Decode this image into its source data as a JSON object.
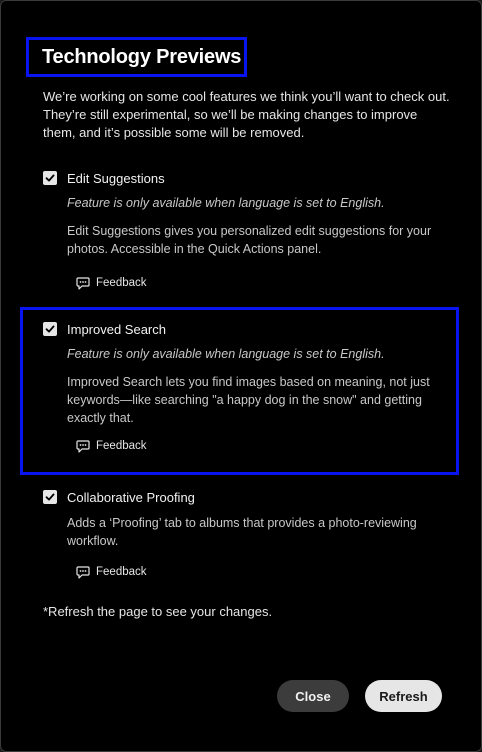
{
  "dialog": {
    "title": "Technology Previews",
    "intro": "We’re working on some cool features we think you’ll want to check out. They’re still experimental, so we’ll be making changes to improve them, and it’s possible some will be removed.",
    "footnote": "*Refresh the page to see your changes.",
    "close_label": "Close",
    "refresh_label": "Refresh",
    "highlight_color": "#0a14f0"
  },
  "features": [
    {
      "name": "Edit Suggestions",
      "checked": true,
      "note": "Feature is only available when language is set to English.",
      "description": "Edit Suggestions gives you personalized edit suggestions for your photos. Accessible in the Quick Actions panel.",
      "feedback_label": "Feedback"
    },
    {
      "name": "Improved Search",
      "checked": true,
      "note": "Feature is only available when language is set to English.",
      "description": "Improved Search lets you find images based on meaning, not just keywords—like searching \"a happy dog in the snow\" and getting exactly that.",
      "feedback_label": "Feedback"
    },
    {
      "name": "Collaborative Proofing",
      "checked": true,
      "note": "",
      "description": "Adds a ‘Proofing’ tab to albums that provides a photo-reviewing workflow.",
      "feedback_label": "Feedback"
    }
  ],
  "icons": {
    "checkbox": "checkmark-icon",
    "feedback": "speech-bubble-icon"
  }
}
